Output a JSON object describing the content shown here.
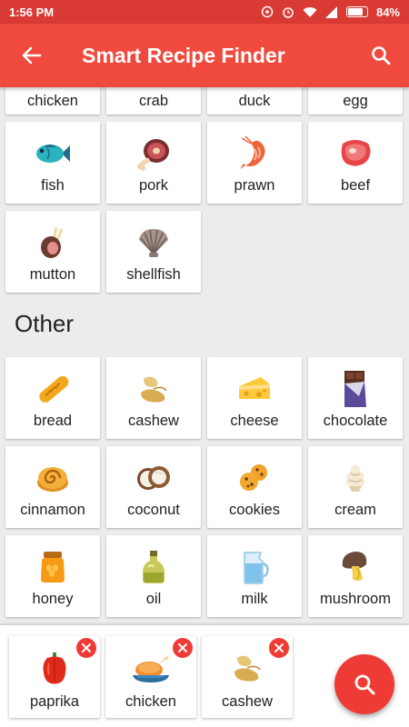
{
  "status_bar": {
    "time": "1:56 PM",
    "battery": "84%"
  },
  "app_bar": {
    "title": "Smart Recipe Finder"
  },
  "meat_items": [
    {
      "label": "chicken"
    },
    {
      "label": "crab"
    },
    {
      "label": "duck"
    },
    {
      "label": "egg"
    },
    {
      "label": "fish",
      "icon": "fish-icon"
    },
    {
      "label": "pork",
      "icon": "ham-icon"
    },
    {
      "label": "prawn",
      "icon": "prawn-icon"
    },
    {
      "label": "beef",
      "icon": "steak-icon"
    },
    {
      "label": "mutton",
      "icon": "mutton-icon"
    },
    {
      "label": "shellfish",
      "icon": "shell-icon"
    }
  ],
  "other_section": {
    "title": "Other",
    "items": [
      {
        "label": "bread",
        "icon": "bread-icon"
      },
      {
        "label": "cashew",
        "icon": "cashew-icon"
      },
      {
        "label": "cheese",
        "icon": "cheese-icon"
      },
      {
        "label": "chocolate",
        "icon": "chocolate-icon"
      },
      {
        "label": "cinnamon",
        "icon": "cinnamon-roll-icon"
      },
      {
        "label": "coconut",
        "icon": "coconut-icon"
      },
      {
        "label": "cookies",
        "icon": "cookies-icon"
      },
      {
        "label": "cream",
        "icon": "cream-icon"
      },
      {
        "label": "honey",
        "icon": "honey-jar-icon"
      },
      {
        "label": "oil",
        "icon": "oil-bottle-icon"
      },
      {
        "label": "milk",
        "icon": "milk-jug-icon"
      },
      {
        "label": "mushroom",
        "icon": "mushroom-icon"
      }
    ]
  },
  "selected": [
    {
      "label": "paprika",
      "icon": "paprika-icon"
    },
    {
      "label": "chicken",
      "icon": "roast-chicken-icon"
    },
    {
      "label": "cashew",
      "icon": "cashew-icon"
    }
  ],
  "colors": {
    "primary": "#f04a3f",
    "status_bar": "#d93a33",
    "accent": "#ef3b36"
  }
}
